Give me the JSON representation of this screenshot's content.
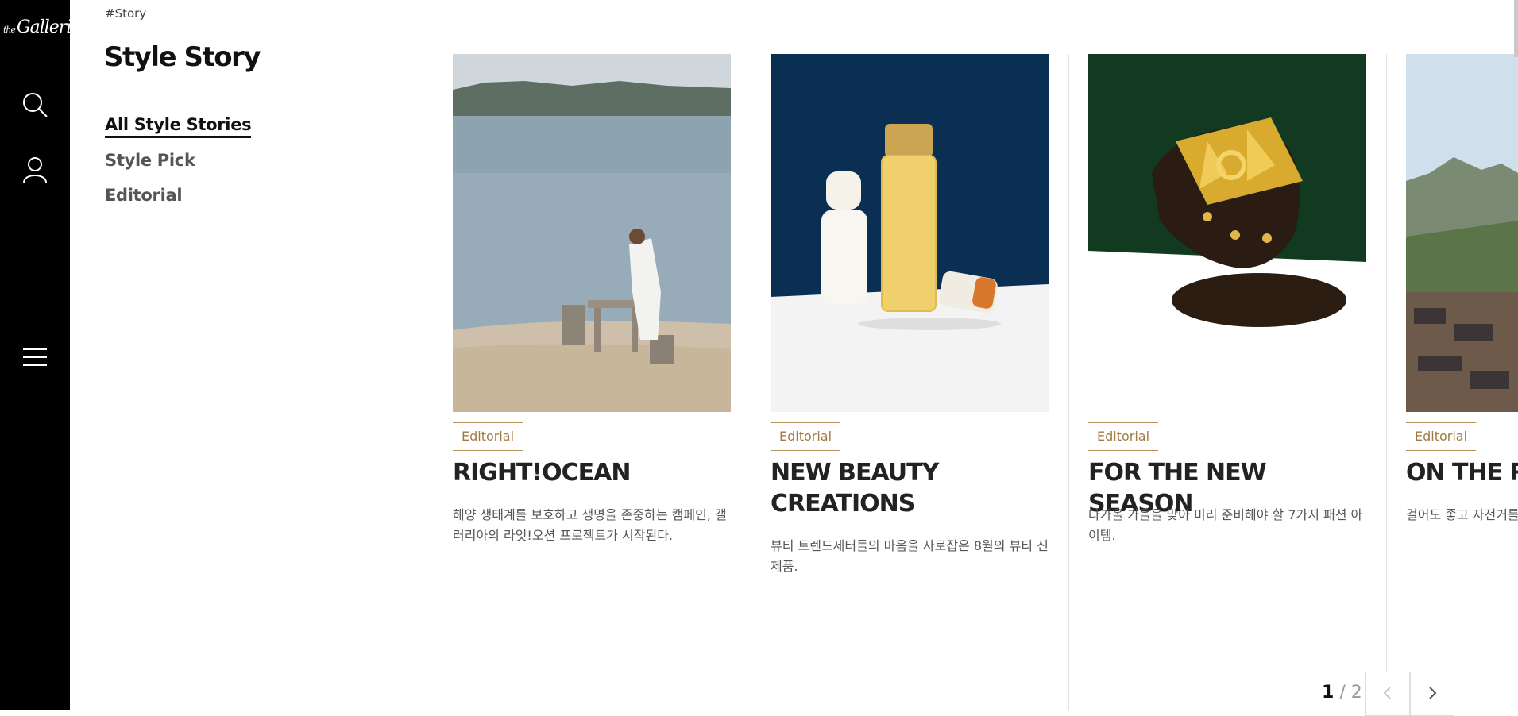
{
  "brand": {
    "logo_prefix": "the",
    "logo_text": "Galleria"
  },
  "breadcrumb": "#Story",
  "page_title": "Style Story",
  "side_nav": [
    {
      "label": "All Style Stories",
      "active": true
    },
    {
      "label": "Style Pick",
      "active": false
    },
    {
      "label": "Editorial",
      "active": false
    }
  ],
  "cards": [
    {
      "tag": "Editorial",
      "title": "RIGHT!OCEAN",
      "desc": "해양 생태계를 보호하고 생명을 존중하는 캠페인, 갤러리아의 라잇!오션 프로젝트가 시작된다."
    },
    {
      "tag": "Editorial",
      "title": "NEW BEAUTY CREATIONS",
      "desc": "뷰티 트렌드세터들의 마음을 사로잡은 8월의 뷰티 신제품."
    },
    {
      "tag": "Editorial",
      "title": "FOR THE NEW SEASON",
      "desc": "다가올 가을을 맞아 미리 준비해야 할 7가지 패션 아이템."
    },
    {
      "tag": "Editorial",
      "title": "ON THE RO",
      "desc": "걸어도 좋고 자전거를 은, 서울과 근교의 '길"
    }
  ],
  "pagination": {
    "current": "1",
    "separator": "/",
    "total": "2"
  },
  "icons": [
    "search-icon",
    "user-icon",
    "menu-icon",
    "chevron-left-icon",
    "chevron-right-icon"
  ],
  "colors": {
    "rail": "#000000",
    "tag": "#a07a45",
    "accent_border": "#b8905a"
  }
}
